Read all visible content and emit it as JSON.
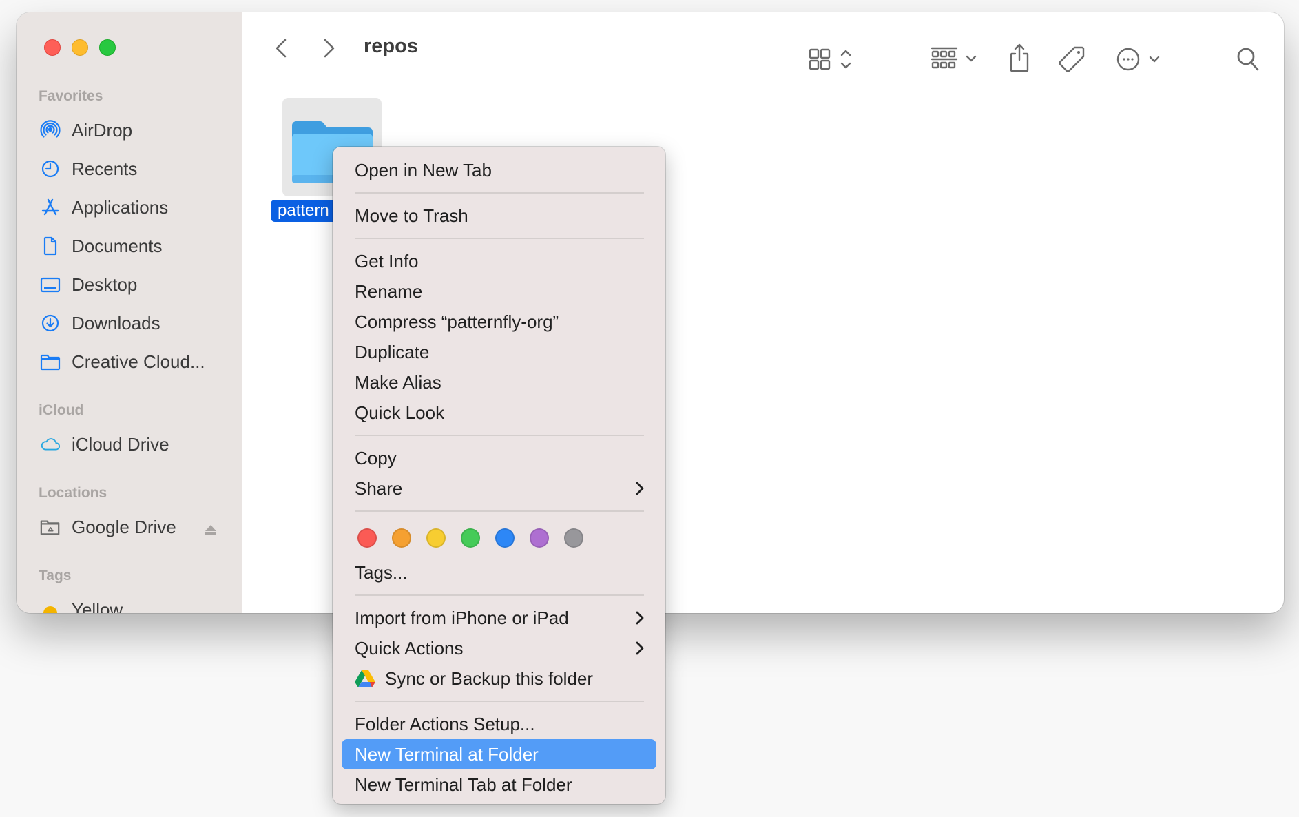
{
  "window": {
    "title": "repos",
    "traffic_lights": [
      "close",
      "minimize",
      "zoom"
    ]
  },
  "sidebar": {
    "sections": [
      {
        "label": "Favorites",
        "items": [
          {
            "label": "AirDrop",
            "icon": "airdrop-icon"
          },
          {
            "label": "Recents",
            "icon": "clock-icon"
          },
          {
            "label": "Applications",
            "icon": "applications-icon"
          },
          {
            "label": "Documents",
            "icon": "document-icon"
          },
          {
            "label": "Desktop",
            "icon": "desktop-icon"
          },
          {
            "label": "Downloads",
            "icon": "download-icon"
          },
          {
            "label": "Creative Cloud...",
            "icon": "folder-icon"
          }
        ]
      },
      {
        "label": "iCloud",
        "items": [
          {
            "label": "iCloud Drive",
            "icon": "cloud-icon"
          }
        ]
      },
      {
        "label": "Locations",
        "items": [
          {
            "label": "Google Drive",
            "icon": "drive-folder-icon",
            "eject": true
          }
        ]
      },
      {
        "label": "Tags",
        "items": [
          {
            "label": "Yellow",
            "color": "#f4b400"
          }
        ]
      }
    ]
  },
  "toolbar": {
    "back": "chevron-left-icon",
    "forward": "chevron-right-icon",
    "view": "icon-view",
    "group": "group-view",
    "share": "share-icon",
    "tag": "tag-icon",
    "more": "ellipsis-icon",
    "search": "search-icon"
  },
  "content": {
    "items": [
      {
        "name": "patternfly-org",
        "name_visible": "pattern",
        "selected": true
      }
    ]
  },
  "context_menu": {
    "groups": [
      [
        {
          "label": "Open in New Tab"
        }
      ],
      [
        {
          "label": "Move to Trash"
        }
      ],
      [
        {
          "label": "Get Info"
        },
        {
          "label": "Rename"
        },
        {
          "label": "Compress “patternfly-org”"
        },
        {
          "label": "Duplicate"
        },
        {
          "label": "Make Alias"
        },
        {
          "label": "Quick Look"
        }
      ],
      [
        {
          "label": "Copy"
        },
        {
          "label": "Share",
          "submenu": true
        }
      ]
    ],
    "tag_colors": [
      {
        "name": "Red",
        "color": "#fb5b55"
      },
      {
        "name": "Orange",
        "color": "#f5a031"
      },
      {
        "name": "Yellow",
        "color": "#f7cd31"
      },
      {
        "name": "Green",
        "color": "#45cb58"
      },
      {
        "name": "Blue",
        "color": "#2d87f6"
      },
      {
        "name": "Purple",
        "color": "#ae6fd1"
      },
      {
        "name": "Gray",
        "color": "#98979b"
      }
    ],
    "tags_label": "Tags...",
    "groups2": [
      [
        {
          "label": "Import from iPhone or iPad",
          "submenu": true
        },
        {
          "label": "Quick Actions",
          "submenu": true
        },
        {
          "label": "Sync or Backup this folder",
          "icon": "google-drive-icon"
        }
      ],
      [
        {
          "label": "Folder Actions Setup..."
        },
        {
          "label": "New Terminal at Folder",
          "highlighted": true
        },
        {
          "label": "New Terminal Tab at Folder"
        }
      ]
    ]
  },
  "colors": {
    "accent": "#0a60e3",
    "menu_highlight": "#539cf7",
    "sidebar_icon": "#1a7cf5",
    "icloud_icon": "#2aa7e0"
  }
}
